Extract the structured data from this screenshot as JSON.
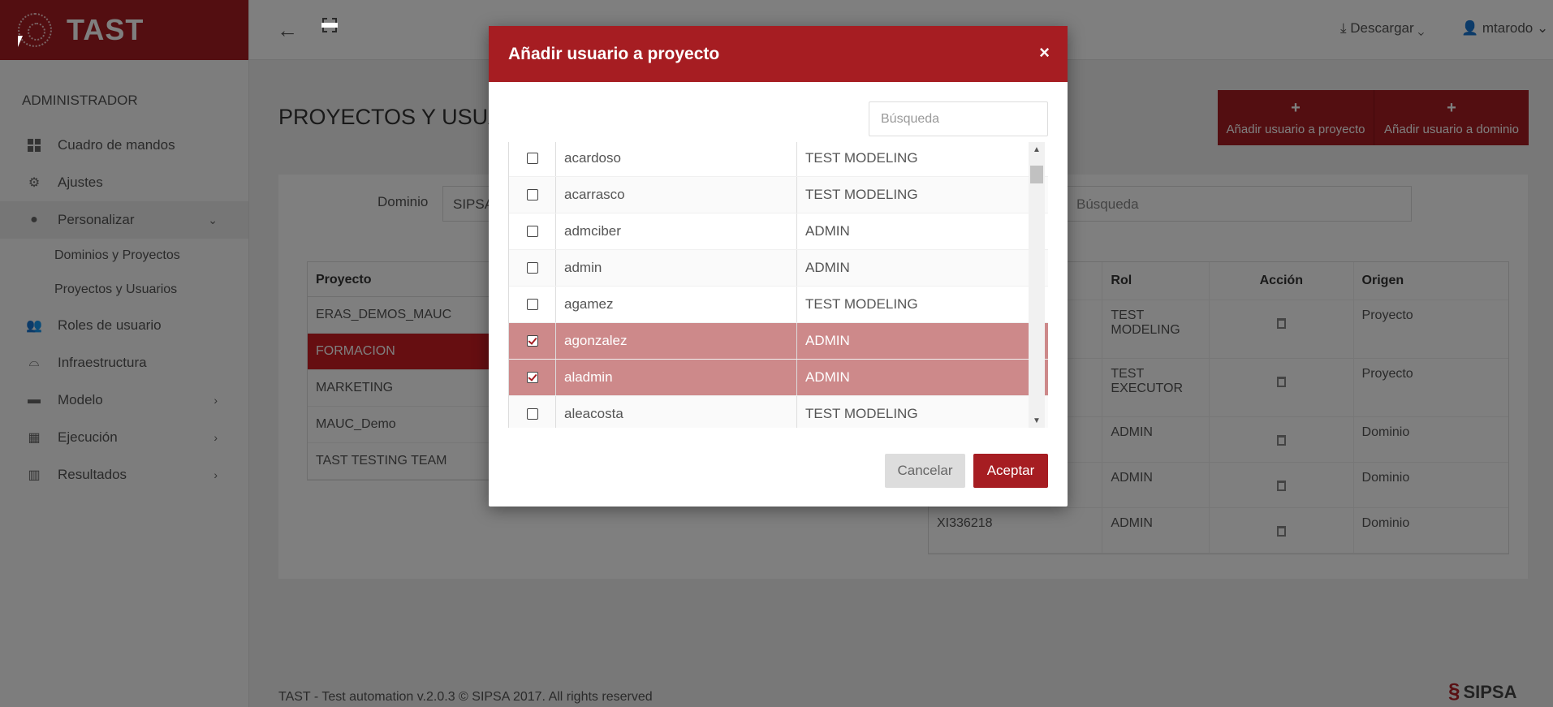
{
  "brand": {
    "name": "TAST"
  },
  "sidebar": {
    "section": "ADMINISTRADOR",
    "items": [
      {
        "label": "Cuadro de mandos",
        "icon": "dashboard-icon"
      },
      {
        "label": "Ajustes",
        "icon": "gear-icon"
      },
      {
        "label": "Personalizar",
        "icon": "dot-icon"
      },
      {
        "label": "Roles de usuario",
        "icon": "users-icon"
      },
      {
        "label": "Infraestructura",
        "icon": "binoculars-icon"
      },
      {
        "label": "Modelo",
        "icon": "briefcase-icon"
      },
      {
        "label": "Ejecución",
        "icon": "calendar-icon"
      },
      {
        "label": "Resultados",
        "icon": "bar-chart-icon"
      }
    ],
    "subitems": [
      "Dominios y Proyectos",
      "Proyectos y Usuarios"
    ]
  },
  "topbar": {
    "download": "Descargar",
    "user": "mtarodo"
  },
  "page": {
    "title": "PROYECTOS Y USUARIOS",
    "add_user_project": "Añadir usuario a proyecto",
    "add_user_domain": "Añadir usuario a dominio",
    "filter_label": "Dominio",
    "filter_value": "SIPSA",
    "search_placeholder": "Búsqueda"
  },
  "projects": {
    "header": "Proyecto",
    "rows": [
      "ERAS_DEMOS_MAUC",
      "FORMACION",
      "MARKETING",
      "MAUC_Demo",
      "TAST TESTING TEAM"
    ]
  },
  "users_table": {
    "headers": [
      "",
      "Rol",
      "Acción",
      "Origen"
    ],
    "rows": [
      {
        "user": "",
        "role": "TEST MODELING",
        "origin": "Proyecto"
      },
      {
        "user": "",
        "role": "TEST EXECUTOR",
        "origin": "Proyecto"
      },
      {
        "user": "",
        "role": "ADMIN",
        "origin": "Dominio"
      },
      {
        "user": "",
        "role": "ADMIN",
        "origin": "Dominio"
      },
      {
        "user": "XI336218",
        "role": "ADMIN",
        "origin": "Dominio"
      }
    ]
  },
  "footer": {
    "text": "TAST - Test automation v.2.0.3 © SIPSA 2017. All rights reserved",
    "logo": "SIPSA"
  },
  "modal": {
    "title": "Añadir usuario a proyecto",
    "close": "×",
    "search_placeholder": "Búsqueda",
    "rows": [
      {
        "name": "acardoso",
        "role": "TEST MODELING",
        "checked": false
      },
      {
        "name": "acarrasco",
        "role": "TEST MODELING",
        "checked": false
      },
      {
        "name": "admciber",
        "role": "ADMIN",
        "checked": false
      },
      {
        "name": "admin",
        "role": "ADMIN",
        "checked": false
      },
      {
        "name": "agamez",
        "role": "TEST MODELING",
        "checked": false
      },
      {
        "name": "agonzalez",
        "role": "ADMIN",
        "checked": true
      },
      {
        "name": "aladmin",
        "role": "ADMIN",
        "checked": true
      },
      {
        "name": "aleacosta",
        "role": "TEST MODELING",
        "checked": false
      }
    ],
    "cancel": "Cancelar",
    "accept": "Aceptar"
  },
  "colors": {
    "brand": "#a61d22",
    "selected_row": "#cd898a"
  }
}
